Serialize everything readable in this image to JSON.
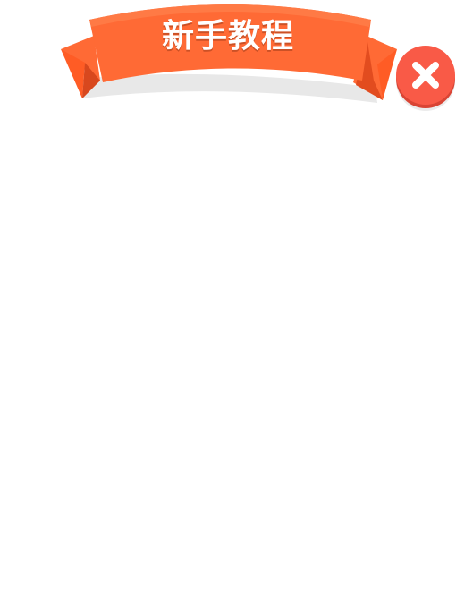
{
  "dialog": {
    "title": "新手教程"
  },
  "icons": {
    "close": "close-icon",
    "banner": "ribbon-banner"
  },
  "colors": {
    "ribbon_main": "#ff6a35",
    "ribbon_dark": "#e24c1f",
    "ribbon_shadow": "#e7e7e7",
    "close_bg": "#f95a47",
    "close_x": "#ffffff"
  }
}
